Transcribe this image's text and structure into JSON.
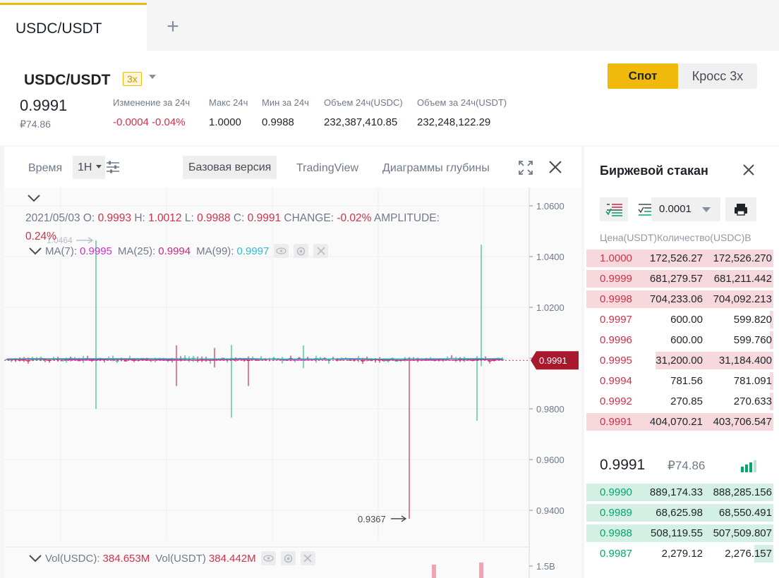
{
  "tabs": {
    "active": "USDC/USDT",
    "add_icon": "plus-icon"
  },
  "header": {
    "pair": "USDC/USDT",
    "leverage": "3x",
    "last_price": "0.9991",
    "last_price_fiat": "₽74.86",
    "stats": [
      {
        "label": "Изменение за 24ч",
        "value": "-0.0004 -0.04%",
        "negative": true
      },
      {
        "label": "Макс 24ч",
        "value": "1.0000"
      },
      {
        "label": "Мин за 24ч",
        "value": "0.9988"
      },
      {
        "label": "Объем 24ч(USDC)",
        "value": "232,387,410.85"
      },
      {
        "label": "Объем за 24ч(USDT)",
        "value": "232,248,122.29"
      }
    ],
    "mode_spot": "Спот",
    "mode_cross": "Кросс 3x"
  },
  "toolbar": {
    "time_label": "Время",
    "interval": "1H",
    "basic_version": "Базовая версия",
    "tradingview": "TradingView",
    "depth_charts": "Диаграммы глубины"
  },
  "legend": {
    "date": "2021/05/03",
    "o_label": "O:",
    "o": "0.9993",
    "h_label": "H:",
    "h": "1.0012",
    "l_label": "L:",
    "l": "0.9988",
    "c_label": "C:",
    "c": "0.9991",
    "change_label": "CHANGE:",
    "change": "-0.02%",
    "amplitude_label": "AMPLITUDE:",
    "amplitude": "0.24%",
    "ma7_label": "MA(7):",
    "ma7": "0.9995",
    "ma25_label": "MA(25):",
    "ma25": "0.9994",
    "ma99_label": "MA(99):",
    "ma99": "0.9997",
    "vol_usdc_label": "Vol(USDC):",
    "vol_usdc": "384.653M",
    "vol_usdt_label": "Vol(USDT)",
    "vol_usdt": "384.442M"
  },
  "chart_data": {
    "type": "candlestick",
    "y_ticks": [
      "1.0600",
      "1.0400",
      "1.0200",
      "1.0000",
      "0.9800",
      "0.9600",
      "0.9400"
    ],
    "ylim": [
      0.9367,
      1.06
    ],
    "current_price": "0.9991",
    "high_marker": "1.0464",
    "low_marker": "0.9367",
    "volume_tick": "1.5B",
    "ma_colors": {
      "ma7": "#cf2fcf",
      "ma25": "#c9268d",
      "ma99": "#2bbbcc"
    }
  },
  "orderbook": {
    "title": "Биржевой стакан",
    "precision": "0.0001",
    "col_heads": "Цена(USDT)Количество(USDC)В",
    "asks": [
      {
        "price": "1.0000",
        "amount": "172,526.27",
        "total": "172,526.270",
        "depth": 0.98
      },
      {
        "price": "0.9999",
        "amount": "681,279.57",
        "total": "681,211.442",
        "depth": 0.98
      },
      {
        "price": "0.9998",
        "amount": "704,233.06",
        "total": "704,092.213",
        "depth": 0.98
      },
      {
        "price": "0.9997",
        "amount": "600.00",
        "total": "599.820",
        "depth": 0.02
      },
      {
        "price": "0.9996",
        "amount": "600.00",
        "total": "599.760",
        "depth": 0.02
      },
      {
        "price": "0.9995",
        "amount": "31,200.00",
        "total": "31,184.400",
        "depth": 0.62
      },
      {
        "price": "0.9994",
        "amount": "781.56",
        "total": "781.091",
        "depth": 0.02
      },
      {
        "price": "0.9992",
        "amount": "270.85",
        "total": "270.633",
        "depth": 0.02
      },
      {
        "price": "0.9991",
        "amount": "404,070.21",
        "total": "403,706.547",
        "depth": 0.98
      }
    ],
    "mid_price": "0.9991",
    "mid_fiat": "₽74.86",
    "bids": [
      {
        "price": "0.9990",
        "amount": "889,174.33",
        "total": "888,285.156",
        "depth": 0.98
      },
      {
        "price": "0.9989",
        "amount": "68,625.98",
        "total": "68,550.491",
        "depth": 0.98
      },
      {
        "price": "0.9988",
        "amount": "508,119.55",
        "total": "507,509.807",
        "depth": 0.98
      },
      {
        "price": "0.9987",
        "amount": "2,279.12",
        "total": "2,276.157",
        "depth": 0.1
      }
    ]
  }
}
